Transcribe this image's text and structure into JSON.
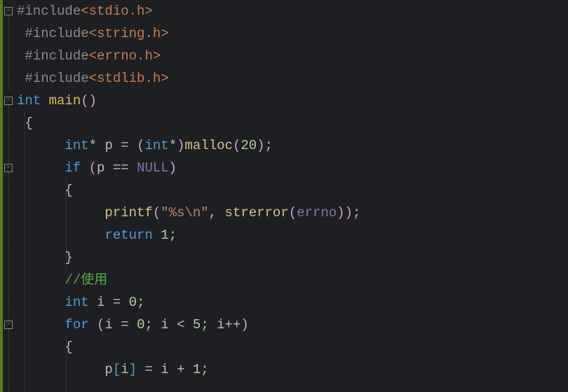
{
  "fold_glyph": "-",
  "code": {
    "l1": {
      "pp": "#include",
      "hdr": "<stdio.h>"
    },
    "l2": {
      "pp": "#include",
      "hdr": "<string.h>"
    },
    "l3": {
      "pp": "#include",
      "hdr": "<errno.h>"
    },
    "l4": {
      "pp": "#include",
      "hdr": "<stdlib.h>"
    },
    "l5": {
      "kw": "int",
      "fn": "main",
      "paren": "()"
    },
    "l6": {
      "brace": "{"
    },
    "l7": {
      "kw": "int",
      "star": "*",
      "id": "p",
      "eq": " = ",
      "po": "(",
      "cast_kw": "int",
      "cast_star": "*",
      "pc": ")",
      "call": "malloc",
      "ao": "(",
      "num": "20",
      "ac": ");"
    },
    "l8": {
      "kw": "if",
      "po": " (",
      "id": "p",
      "op": " == ",
      "null": "NULL",
      "pc": ")"
    },
    "l9": {
      "brace": "{"
    },
    "l10": {
      "call": "printf",
      "po": "(",
      "str": "\"%s\\n\"",
      "comma": ", ",
      "call2": "strerror",
      "ao": "(",
      "errno": "errno",
      "ac": ")",
      "end": ");"
    },
    "l11": {
      "kw": "return",
      "sp": " ",
      "num": "1",
      "end": ";"
    },
    "l12": {
      "brace": "}"
    },
    "l13": {
      "cmt": "//使用"
    },
    "l14": {
      "kw": "int",
      "sp": " ",
      "id": "i",
      "eq": " = ",
      "num": "0",
      "end": ";"
    },
    "l15": {
      "kw": "for",
      "po": " (",
      "id1": "i",
      "eq1": " = ",
      "n1": "0",
      "semi1": "; ",
      "id2": "i",
      "lt": " < ",
      "n2": "5",
      "semi2": "; ",
      "id3": "i",
      "inc": "++",
      "pc": ")"
    },
    "l16": {
      "brace": "{"
    },
    "l17": {
      "id": "p",
      "lb": "[",
      "idx": "i",
      "rb": "]",
      "eq": " = ",
      "id2": "i",
      "plus": " + ",
      "num": "1",
      "end": ";"
    }
  }
}
